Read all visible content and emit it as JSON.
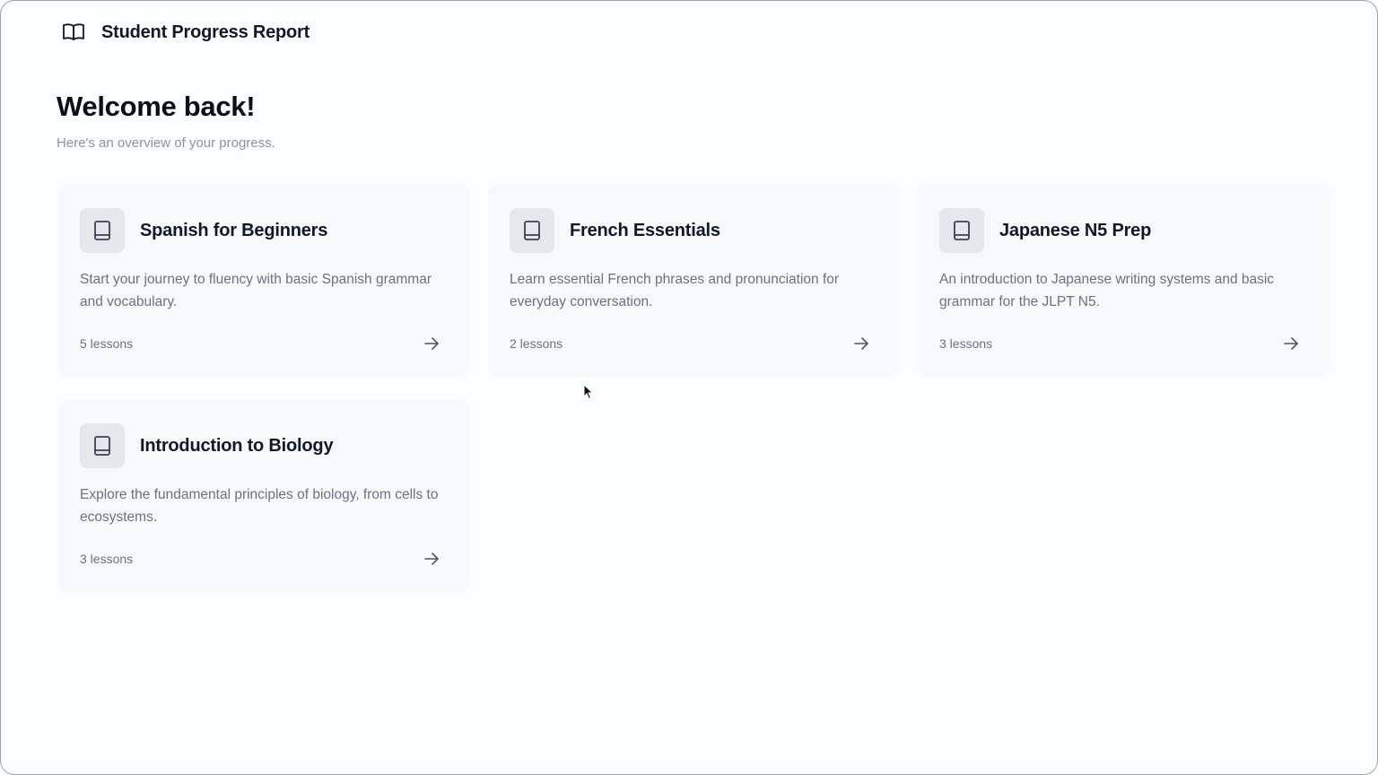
{
  "header": {
    "title": "Student Progress Report",
    "icon": "book-open-icon"
  },
  "welcome": {
    "title": "Welcome back!",
    "subtitle": "Here's an overview of your progress."
  },
  "courses": [
    {
      "title": "Spanish for Beginners",
      "description": "Start your journey to fluency with basic Spanish grammar and vocabulary.",
      "lessons": "5 lessons"
    },
    {
      "title": "French Essentials",
      "description": "Learn essential French phrases and pronunciation for everyday conversation.",
      "lessons": "2 lessons"
    },
    {
      "title": "Japanese N5 Prep",
      "description": "An introduction to Japanese writing systems and basic grammar for the JLPT N5.",
      "lessons": "3 lessons"
    },
    {
      "title": "Introduction to Biology",
      "description": "Explore the fundamental principles of biology, from cells to ecosystems.",
      "lessons": "3 lessons"
    }
  ],
  "colors": {
    "background": "#fcfdfe",
    "card": "#f6f8fa",
    "icon_tile": "#e5e7eb",
    "text_primary": "#111827",
    "text_muted": "#6b7280"
  }
}
